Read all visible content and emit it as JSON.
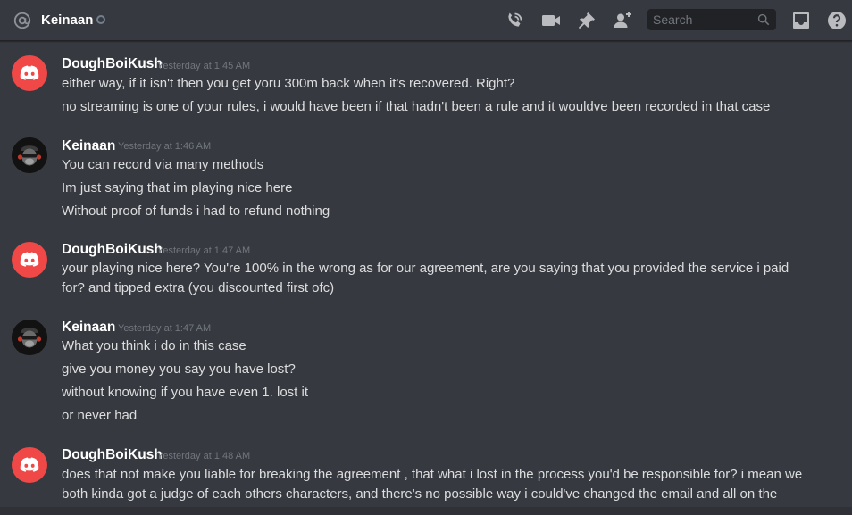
{
  "header": {
    "dm_name": "Keinaan",
    "status": "offline",
    "icons": [
      "at-sign-icon",
      "call-icon",
      "video-icon",
      "pin-icon",
      "add-friend-icon",
      "inbox-icon",
      "help-icon"
    ],
    "search": {
      "placeholder": "Search"
    }
  },
  "colors": {
    "background": "#36393f",
    "discord_red": "#f04747",
    "username": "#ffffff",
    "text": "#dcddde",
    "timestamp": "#72767d"
  },
  "messages": [
    {
      "author": "DoughBoiKush",
      "avatar": "discord-logo-avatar",
      "timestamp": "Yesterday at 1:45 AM",
      "lines": [
        "either way, if it isn't then you get yoru 300m back when it's recovered. Right?",
        "no streaming is one of your rules, i would have been if that hadn't been a rule and it wouldve been recorded in that case"
      ]
    },
    {
      "author": "Keinaan",
      "avatar": "keinaan-avatar",
      "timestamp": "Yesterday at 1:46 AM",
      "lines": [
        "You can record via many methods",
        "Im just saying that im playing nice here",
        "Without proof of funds i had to refund nothing"
      ]
    },
    {
      "author": "DoughBoiKush",
      "avatar": "discord-logo-avatar",
      "timestamp": "Yesterday at 1:47 AM",
      "lines": [
        "your playing nice here? You're 100% in the wrong as for our agreement, are you saying that you provided the service i paid for? and tipped extra (you discounted first ofc)"
      ]
    },
    {
      "author": "Keinaan",
      "avatar": "keinaan-avatar",
      "timestamp": "Yesterday at 1:47 AM",
      "lines": [
        "What you think i do in this case",
        "give you money you say you have lost?",
        "without knowing if you have even 1. lost it",
        "or never had"
      ]
    },
    {
      "author": "DoughBoiKush",
      "avatar": "discord-logo-avatar",
      "timestamp": "Yesterday at 1:48 AM",
      "lines": [
        "does that not make you liable for breaking the agreement , that what i lost in the process you'd be responsible for? i mean we both kinda got a judge of each others characters, and there's no possible way i could've changed the email and all on the"
      ]
    }
  ]
}
